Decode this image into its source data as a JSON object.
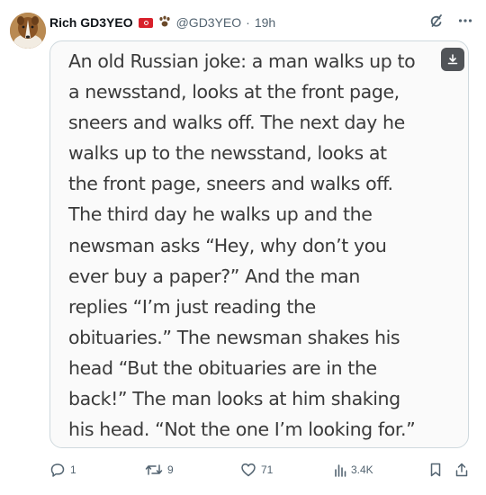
{
  "author": {
    "name": "Rich GD3YEO",
    "handle": "@GD3YEO",
    "separator": "·",
    "time": "19h"
  },
  "icons": {
    "avatar": "collie-dog-avatar",
    "flag": "red-flag-icon",
    "emoji": "paw-prints-icon",
    "grok": "grok-icon",
    "more": "more-icon",
    "download": "download-icon"
  },
  "media": {
    "lines": [
      "An old Russian joke: a man walks up to",
      "a newsstand, looks at the front page,",
      "sneers and walks off. The next day he",
      "walks up to the newsstand, looks at",
      "the front page, sneers and walks off.",
      "The third day he walks up and the",
      "newsman asks “Hey, why don’t you",
      "ever buy a paper?” And the man",
      "replies “I’m just reading the",
      "obituaries.” The newsman shakes his",
      "head “But the obituaries are in the",
      "back!” The man looks at him shaking",
      "his head. “Not the one I’m looking for.”"
    ]
  },
  "actions": {
    "replies": "1",
    "reposts": "9",
    "likes": "71",
    "views": "3.4K"
  },
  "colors": {
    "text": "#0f1419",
    "secondary": "#536471",
    "border": "#cfd9de",
    "flag": "#d8202a"
  }
}
